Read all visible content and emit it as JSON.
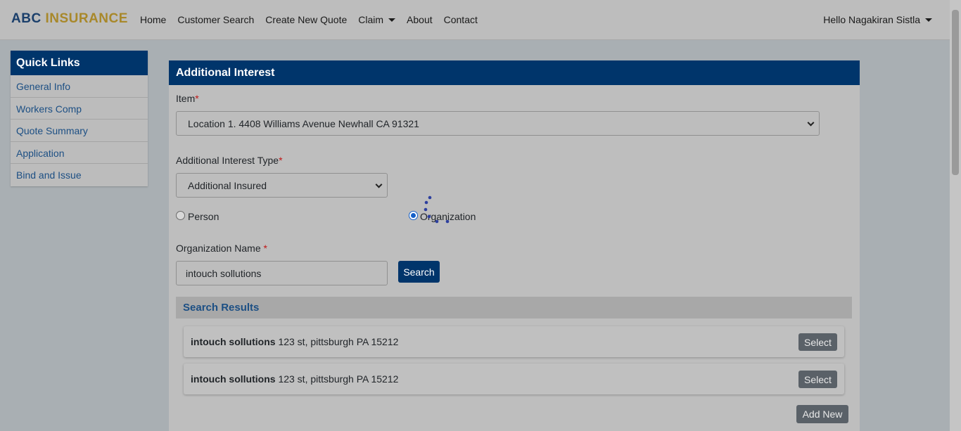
{
  "brand": {
    "part1": "ABC",
    "part2": "INSURANCE"
  },
  "nav": {
    "home": "Home",
    "customer_search": "Customer Search",
    "create_quote": "Create New Quote",
    "claim": "Claim",
    "about": "About",
    "contact": "Contact",
    "user": "Hello Nagakiran Sistla"
  },
  "quick_links": {
    "title": "Quick Links",
    "items": [
      "General Info",
      "Workers Comp",
      "Quote Summary",
      "Application",
      "Bind and Issue"
    ]
  },
  "panel": {
    "title": "Additional Interest",
    "item_label": "Item",
    "item_value": "Location 1. 4408 Williams Avenue Newhall CA 91321",
    "type_label": "Additional Interest Type",
    "type_value": "Additional Insured",
    "radio_person": "Person",
    "radio_org": "Organization",
    "selected_radio": "Organization",
    "org_name_label": "Organization Name",
    "org_name_value": "intouch sollutions",
    "required_mark": "*",
    "search_button": "Search",
    "results_title": "Search Results",
    "results": [
      {
        "name": "intouch sollutions",
        "address": "123 st, pittsburgh PA 15212",
        "action": "Select"
      },
      {
        "name": "intouch sollutions",
        "address": "123 st, pittsburgh PA 15212",
        "action": "Select"
      }
    ],
    "add_new_button": "Add New"
  },
  "colors": {
    "brand_navy": "#00356b",
    "brand_gold": "#a8882a",
    "link_blue": "#1c4f84",
    "required_red": "#c01818"
  },
  "icons": [
    "caret-down-icon",
    "chevron-down-icon",
    "loading-spinner-icon"
  ]
}
